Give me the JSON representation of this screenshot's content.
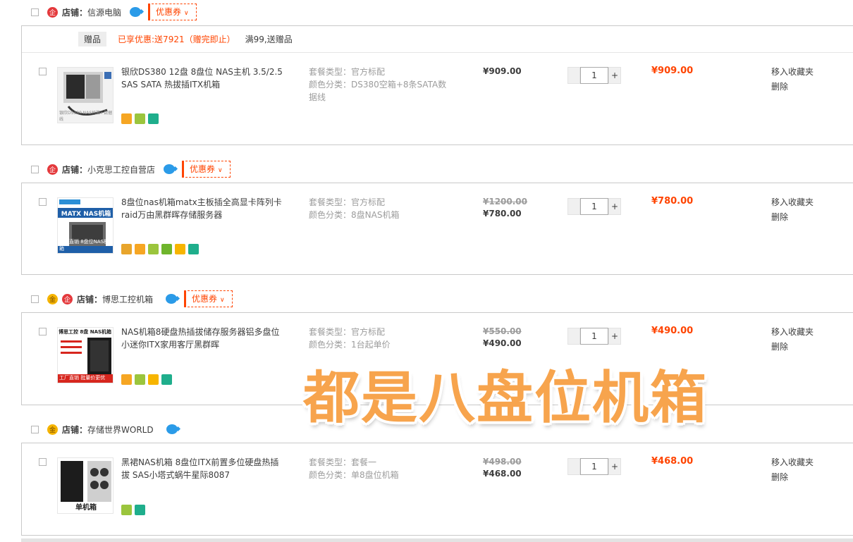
{
  "common": {
    "shop_label": "店铺：",
    "coupon_label": "优惠券",
    "move_to_fav": "移入收藏夹",
    "delete": "删除",
    "qty_plus": "+",
    "qty_minus": ""
  },
  "shops": [
    {
      "name": "信源电脑",
      "gift": {
        "tag": "赠品",
        "promo": "已享优惠:送7921（赠完即止）",
        "note": "满99,送赠品"
      },
      "item": {
        "title": "银欣DS380 12盘 8盘位 NAS主机 3.5/2.5 SAS SATA 热拔插ITX机箱",
        "sku_type": "套餐类型：官方标配",
        "sku_color": "颜色分类：DS380空箱+8条SATA数据线",
        "price_old": "",
        "price": "¥909.00",
        "qty": "1",
        "subtotal": "¥909.00",
        "thumb_caption": "银欣DS380 NAS机箱+数据线"
      }
    },
    {
      "name": "小克思工控自营店",
      "item": {
        "title": "8盘位nas机箱matx主板插全高显卡阵列卡raid万由黑群晖存储服务器",
        "sku_type": "套餐类型：官方标配",
        "sku_color": "颜色分类：8盘NAS机箱",
        "price_old": "¥1200.00",
        "price": "¥780.00",
        "qty": "1",
        "subtotal": "¥780.00",
        "thumb_title": "MATX NAS机箱",
        "thumb_caption": "工厂直销  8盘位NAS机箱"
      }
    },
    {
      "name": "博思工控机箱",
      "item": {
        "title": "NAS机箱8硬盘热插拔储存服务器铝多盘位小迷你ITX家用客厅黑群晖",
        "sku_type": "套餐类型：官方标配",
        "sku_color": "颜色分类：1台起单价",
        "price_old": "¥550.00",
        "price": "¥490.00",
        "qty": "1",
        "subtotal": "¥490.00",
        "thumb_title": "博思工控 8盘 NAS机箱",
        "thumb_caption": "工厂直销  批量价更优"
      }
    },
    {
      "name": "存储世界WORLD",
      "item": {
        "title": "黑裙NAS机箱 8盘位ITX前置多位硬盘热插拔 SAS小塔式蜗牛星际8087",
        "sku_type": "套餐类型：套餐一",
        "sku_color": "颜色分类：单8盘位机箱",
        "price_old": "¥498.00",
        "price": "¥468.00",
        "qty": "1",
        "subtotal": "¥468.00",
        "thumb_caption": "单机箱"
      }
    }
  ],
  "overlay_text": "都是八盘位机箱",
  "colors": {
    "accent": "#ff4400",
    "overlay": "#f7a44d"
  }
}
